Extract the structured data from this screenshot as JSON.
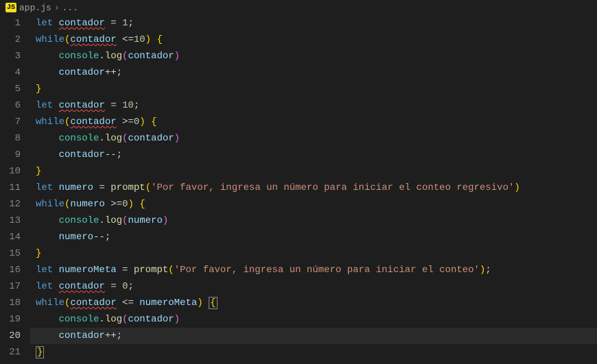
{
  "breadcrumb": {
    "icon": "JS",
    "file": "app.js",
    "sep": "›",
    "tail": "..."
  },
  "editor": {
    "activeLine": 20,
    "lines": [
      {
        "n": 1,
        "indent": 0,
        "tokens": [
          [
            "kw",
            "let"
          ],
          [
            "sp",
            " "
          ],
          [
            "var squiggle",
            "contador"
          ],
          [
            "sp",
            " "
          ],
          [
            "op",
            "="
          ],
          [
            "sp",
            " "
          ],
          [
            "num",
            "1"
          ],
          [
            "pun",
            ";"
          ]
        ]
      },
      {
        "n": 2,
        "indent": 0,
        "tokens": [
          [
            "kw",
            "while"
          ],
          [
            "brc",
            "("
          ],
          [
            "var squiggle",
            "contador"
          ],
          [
            "sp",
            " "
          ],
          [
            "op",
            "<="
          ],
          [
            "num",
            "10"
          ],
          [
            "brc",
            ")"
          ],
          [
            "sp",
            " "
          ],
          [
            "brc",
            "{"
          ]
        ]
      },
      {
        "n": 3,
        "indent": 1,
        "tokens": [
          [
            "obj",
            "console"
          ],
          [
            "pun",
            "."
          ],
          [
            "fn",
            "log"
          ],
          [
            "brcP",
            "("
          ],
          [
            "var",
            "contador"
          ],
          [
            "brcP",
            ")"
          ]
        ]
      },
      {
        "n": 4,
        "indent": 1,
        "tokens": [
          [
            "var",
            "contador"
          ],
          [
            "op",
            "++"
          ],
          [
            "pun",
            ";"
          ]
        ]
      },
      {
        "n": 5,
        "indent": 0,
        "tokens": [
          [
            "brc",
            "}"
          ]
        ]
      },
      {
        "n": 6,
        "indent": 0,
        "tokens": [
          [
            "kw",
            "let"
          ],
          [
            "sp",
            " "
          ],
          [
            "var squiggle",
            "contador"
          ],
          [
            "sp",
            " "
          ],
          [
            "op",
            "="
          ],
          [
            "sp",
            " "
          ],
          [
            "num",
            "10"
          ],
          [
            "pun",
            ";"
          ]
        ]
      },
      {
        "n": 7,
        "indent": 0,
        "tokens": [
          [
            "kw",
            "while"
          ],
          [
            "brc",
            "("
          ],
          [
            "var squiggle",
            "contador"
          ],
          [
            "sp",
            " "
          ],
          [
            "op",
            ">="
          ],
          [
            "num",
            "0"
          ],
          [
            "brc",
            ")"
          ],
          [
            "sp",
            " "
          ],
          [
            "brc",
            "{"
          ]
        ]
      },
      {
        "n": 8,
        "indent": 1,
        "tokens": [
          [
            "obj",
            "console"
          ],
          [
            "pun",
            "."
          ],
          [
            "fn",
            "log"
          ],
          [
            "brcP",
            "("
          ],
          [
            "var",
            "contador"
          ],
          [
            "brcP",
            ")"
          ]
        ]
      },
      {
        "n": 9,
        "indent": 1,
        "tokens": [
          [
            "var",
            "contador"
          ],
          [
            "op",
            "--"
          ],
          [
            "pun",
            ";"
          ]
        ]
      },
      {
        "n": 10,
        "indent": 0,
        "tokens": [
          [
            "brc",
            "}"
          ]
        ]
      },
      {
        "n": 11,
        "indent": 0,
        "tokens": [
          [
            "kw",
            "let"
          ],
          [
            "sp",
            " "
          ],
          [
            "var",
            "numero"
          ],
          [
            "sp",
            " "
          ],
          [
            "op",
            "="
          ],
          [
            "sp",
            " "
          ],
          [
            "fn",
            "prompt"
          ],
          [
            "brc",
            "("
          ],
          [
            "str",
            "'Por favor, ingresa un número para iniciar el conteo regresivo'"
          ],
          [
            "brc",
            ")"
          ]
        ]
      },
      {
        "n": 12,
        "indent": 0,
        "tokens": [
          [
            "kw",
            "while"
          ],
          [
            "brc",
            "("
          ],
          [
            "var",
            "numero"
          ],
          [
            "sp",
            " "
          ],
          [
            "op",
            ">="
          ],
          [
            "num",
            "0"
          ],
          [
            "brc",
            ")"
          ],
          [
            "sp",
            " "
          ],
          [
            "brc",
            "{"
          ]
        ]
      },
      {
        "n": 13,
        "indent": 1,
        "tokens": [
          [
            "obj",
            "console"
          ],
          [
            "pun",
            "."
          ],
          [
            "fn",
            "log"
          ],
          [
            "brcP",
            "("
          ],
          [
            "var",
            "numero"
          ],
          [
            "brcP",
            ")"
          ]
        ]
      },
      {
        "n": 14,
        "indent": 1,
        "tokens": [
          [
            "var",
            "numero"
          ],
          [
            "op",
            "--"
          ],
          [
            "pun",
            ";"
          ]
        ]
      },
      {
        "n": 15,
        "indent": 0,
        "tokens": [
          [
            "brc",
            "}"
          ]
        ]
      },
      {
        "n": 16,
        "indent": 0,
        "tokens": [
          [
            "kw",
            "let"
          ],
          [
            "sp",
            " "
          ],
          [
            "var",
            "numeroMeta"
          ],
          [
            "sp",
            " "
          ],
          [
            "op",
            "="
          ],
          [
            "sp",
            " "
          ],
          [
            "fn",
            "prompt"
          ],
          [
            "brc",
            "("
          ],
          [
            "str",
            "'Por favor, ingresa un número para iniciar el conteo'"
          ],
          [
            "brc",
            ")"
          ],
          [
            "pun",
            ";"
          ]
        ]
      },
      {
        "n": 17,
        "indent": 0,
        "tokens": [
          [
            "kw",
            "let"
          ],
          [
            "sp",
            " "
          ],
          [
            "var squiggle",
            "contador"
          ],
          [
            "sp",
            " "
          ],
          [
            "op",
            "="
          ],
          [
            "sp",
            " "
          ],
          [
            "num",
            "0"
          ],
          [
            "pun",
            ";"
          ]
        ]
      },
      {
        "n": 18,
        "indent": 0,
        "tokens": [
          [
            "kw",
            "while"
          ],
          [
            "brc",
            "("
          ],
          [
            "var squiggle",
            "contador"
          ],
          [
            "sp",
            " "
          ],
          [
            "op",
            "<="
          ],
          [
            "sp",
            " "
          ],
          [
            "var",
            "numeroMeta"
          ],
          [
            "brc",
            ")"
          ],
          [
            "sp",
            " "
          ],
          [
            "brc boxbr",
            "{"
          ]
        ]
      },
      {
        "n": 19,
        "indent": 1,
        "tokens": [
          [
            "obj",
            "console"
          ],
          [
            "pun",
            "."
          ],
          [
            "fn",
            "log"
          ],
          [
            "brcP",
            "("
          ],
          [
            "var",
            "contador"
          ],
          [
            "brcP",
            ")"
          ]
        ]
      },
      {
        "n": 20,
        "indent": 1,
        "tokens": [
          [
            "var",
            "contador"
          ],
          [
            "op",
            "++"
          ],
          [
            "pun",
            ";"
          ]
        ]
      },
      {
        "n": 21,
        "indent": 0,
        "tokens": [
          [
            "brc boxbr",
            "}"
          ]
        ]
      }
    ]
  }
}
